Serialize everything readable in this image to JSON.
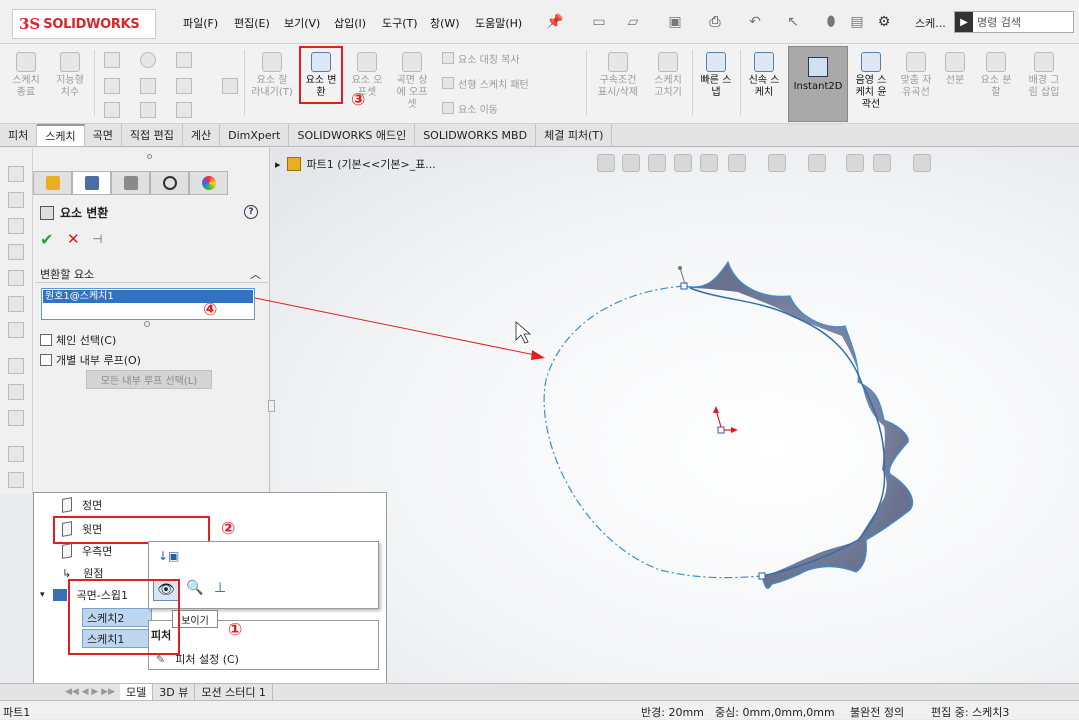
{
  "app": {
    "brand": "SOLIDWORKS",
    "brand_prefix": "3S"
  },
  "menu": [
    "파일(F)",
    "편집(E)",
    "보기(V)",
    "삽입(I)",
    "도구(T)",
    "창(W)",
    "도움말(H)"
  ],
  "title_short": "스케...",
  "search_placeholder": "명령 검색",
  "ribbon": {
    "exit_sketch": "스케치\n종료",
    "smart_dim": "지능형\n치수",
    "trim": "요소 잘\n라내기(T)",
    "convert": "요소 변\n환",
    "offset": "요소 오\n프셋",
    "offset_surface": "곡면 상\n에 오프\n셋",
    "mirror": "요소 대칭 복사",
    "linear_pattern": "선형 스케치 패턴",
    "move": "요소 이동",
    "relations": "구속조건\n표시/삭제",
    "fix_sketch": "스케치\n고치기",
    "quick_snaps": "빠른 스\n냅",
    "rapid_sketch": "신속 스\n케치",
    "instant2d": "Instant2D",
    "shaded_contours": "음영 스\n케치 윤\n곽선",
    "fit_spline": "맞춤 자\n유곡선",
    "segment": "선분",
    "split": "요소 분\n할",
    "sketch_picture": "배경 그\n림 삽입"
  },
  "tabs": [
    "피처",
    "스케치",
    "곡면",
    "직접 편집",
    "계산",
    "DimXpert",
    "SOLIDWORKS 애드인",
    "SOLIDWORKS MBD",
    "체결 피처(T)"
  ],
  "active_tab": "스케치",
  "property_manager": {
    "title": "요소 변환",
    "help": "?",
    "ok": "✔",
    "cancel": "✕",
    "pin": "⊣",
    "group_label": "변환할 요소",
    "selected_item": "원호1@스케치1",
    "chain_select": "체인 선택(C)",
    "inner_loops": "개별 내부 루프(O)",
    "select_all_loops": "모든 내부 루프 선택(L)"
  },
  "viewport": {
    "part_label": "파트1  (기본<<기본>_표..."
  },
  "tree": {
    "front": "정면",
    "top": "윗면",
    "right": "우측면",
    "origin": "원점",
    "sweep": "곡면-스윕1",
    "sketch2": "스케치2",
    "sketch1": "스케치1"
  },
  "context": {
    "tooltip": "보이기",
    "section": "피처",
    "feature_props": "피처 설정 (C)"
  },
  "annotations": {
    "n1": "①",
    "n2": "②",
    "n3": "③",
    "n4": "④"
  },
  "bottom_tabs": [
    "모델",
    "3D 뷰",
    "모션 스터디 1"
  ],
  "status": {
    "part": "파트1",
    "radius": "반경: 20mm",
    "center": "중심: 0mm,0mm,0mm",
    "state": "불완전 정의",
    "editing": "편집 중: 스케치3"
  },
  "colors": {
    "accent": "#3272c4",
    "highlight": "#e02020",
    "sketch": "#3a8fd6"
  }
}
